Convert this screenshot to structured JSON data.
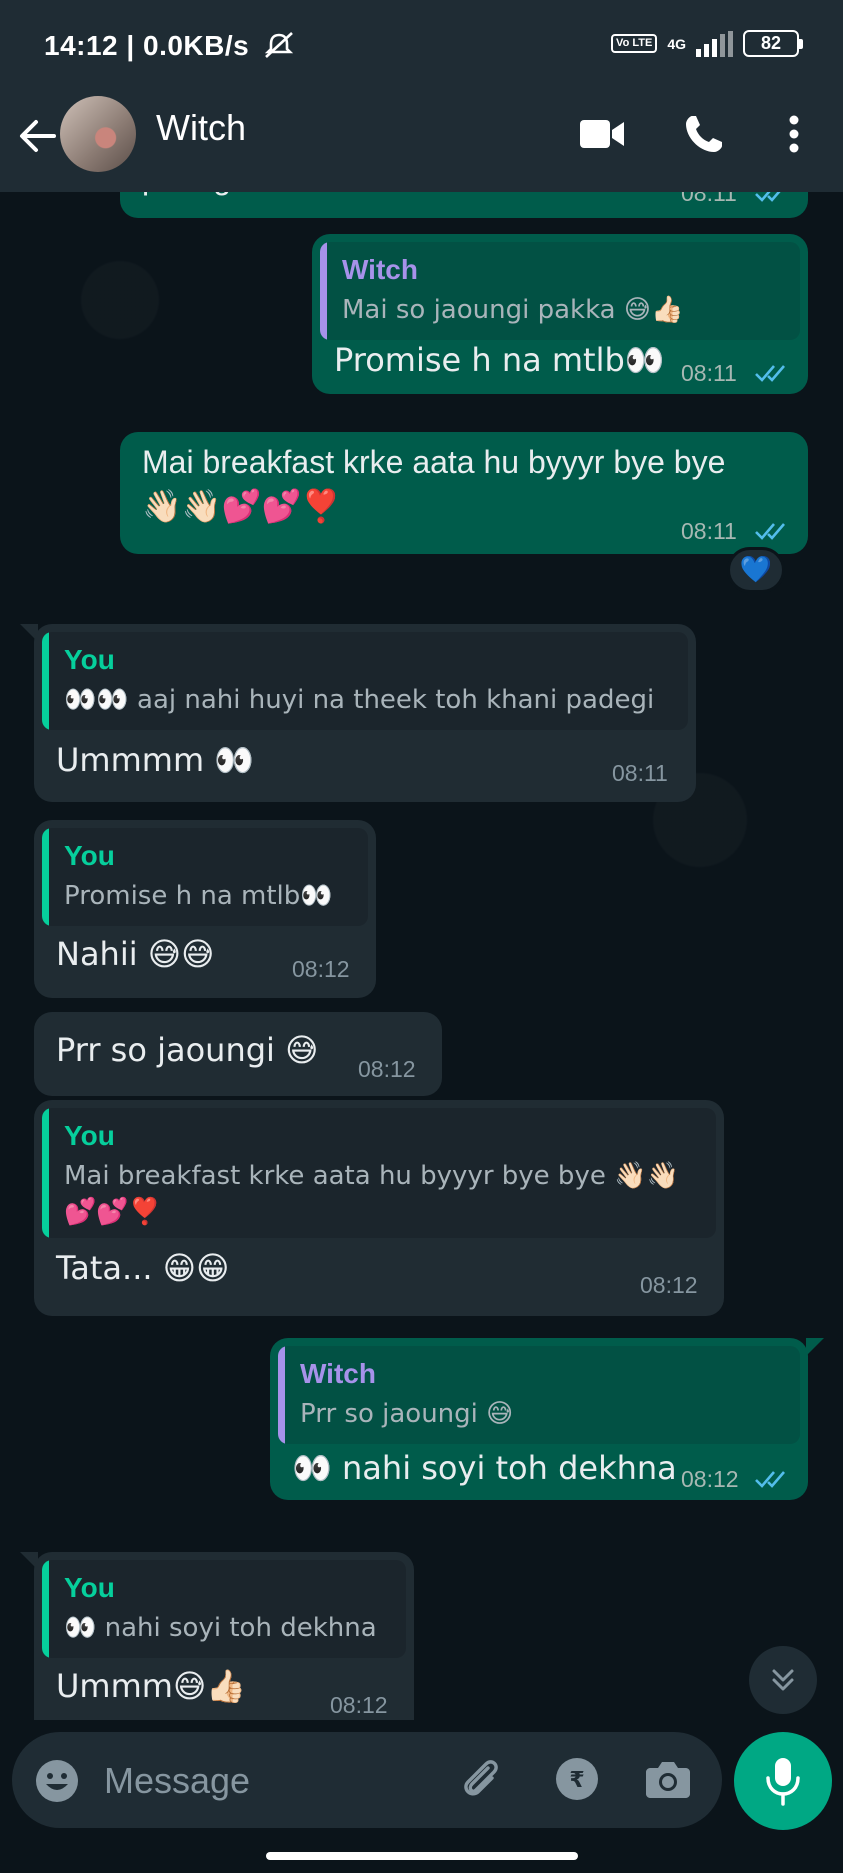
{
  "status_bar": {
    "time": "14:12 | 0.0KB/s",
    "volte": "Vo LTE",
    "network": "4G",
    "battery": "82"
  },
  "header": {
    "contact_name": "Witch"
  },
  "messages": [
    {
      "direction": "outgoing",
      "text": "padegi",
      "time": "08:11",
      "status": "read"
    },
    {
      "direction": "outgoing",
      "quote_author": "Witch",
      "quote_text": "Mai so jaoungi pakka 😅👍🏻",
      "text": "Promise h na mtlb👀",
      "time": "08:11",
      "status": "read"
    },
    {
      "direction": "outgoing",
      "text": "Mai breakfast krke aata hu byyyr bye bye",
      "text_emoji": "👋🏻👋🏻💕💕❣️",
      "time": "08:11",
      "status": "read",
      "reaction": "💙"
    },
    {
      "direction": "incoming",
      "quote_author": "You",
      "quote_text": "👀👀 aaj nahi huyi na theek toh khani padegi",
      "text": "Ummmm 👀",
      "time": "08:11"
    },
    {
      "direction": "incoming",
      "quote_author": "You",
      "quote_text": "Promise h na mtlb👀",
      "text": "Nahii 😅😅",
      "time": "08:12"
    },
    {
      "direction": "incoming",
      "text": "Prr so jaoungi 😅",
      "time": "08:12"
    },
    {
      "direction": "incoming",
      "quote_author": "You",
      "quote_text": "Mai breakfast krke aata hu byyyr bye bye 👋🏻👋🏻",
      "quote_text_2": "💕💕❣️",
      "text": "Tata... 😁😁",
      "time": "08:12"
    },
    {
      "direction": "outgoing",
      "quote_author": "Witch",
      "quote_text": "Prr so jaoungi 😅",
      "text": "👀 nahi soyi toh dekhna",
      "time": "08:12",
      "status": "read"
    },
    {
      "direction": "incoming",
      "quote_author": "You",
      "quote_text": "👀 nahi soyi toh dekhna",
      "text": "Ummm😅👍🏻",
      "time": "08:12"
    }
  ],
  "composer": {
    "placeholder": "Message"
  },
  "colors": {
    "outgoing_bubble": "#005c4b",
    "incoming_bubble": "#202c33",
    "quote_you": "#06cf9c",
    "quote_witch": "#a792ea",
    "read_ticks": "#53bdeb",
    "accent_mic": "#00a884"
  },
  "icons": [
    "back-arrow-icon",
    "video-call-icon",
    "phone-icon",
    "more-options-icon",
    "emoji-icon",
    "attach-icon",
    "rupee-payment-icon",
    "camera-icon",
    "mic-icon",
    "scroll-down-icon"
  ]
}
